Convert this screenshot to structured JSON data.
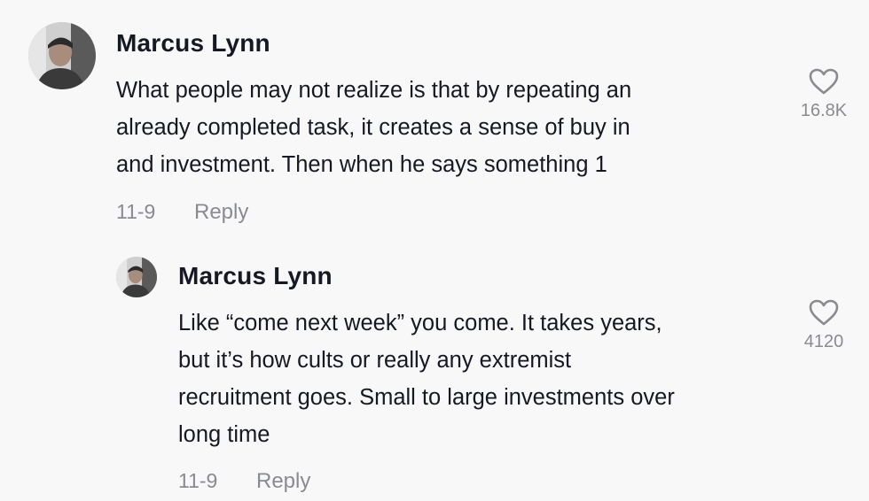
{
  "comments": [
    {
      "username": "Marcus Lynn",
      "lines": [
        "What people may not realize is that by repeating an",
        "already completed task, it creates a sense of buy in",
        "and investment. Then when he says something 1"
      ],
      "date": "11-9",
      "reply_label": "Reply",
      "like_count": "16.8K",
      "like_icon": "heart-outline-icon"
    },
    {
      "username": "Marcus Lynn",
      "lines": [
        "Like “come next week” you come. It takes years,",
        "but it’s how cults or really any extremist",
        "recruitment goes. Small to large investments over",
        "long time"
      ],
      "date": "11-9",
      "reply_label": "Reply",
      "like_count": "4120",
      "like_icon": "heart-outline-icon"
    }
  ],
  "colors": {
    "background": "#f8f8f8",
    "text": "#161823",
    "muted": "#8a8b91"
  }
}
